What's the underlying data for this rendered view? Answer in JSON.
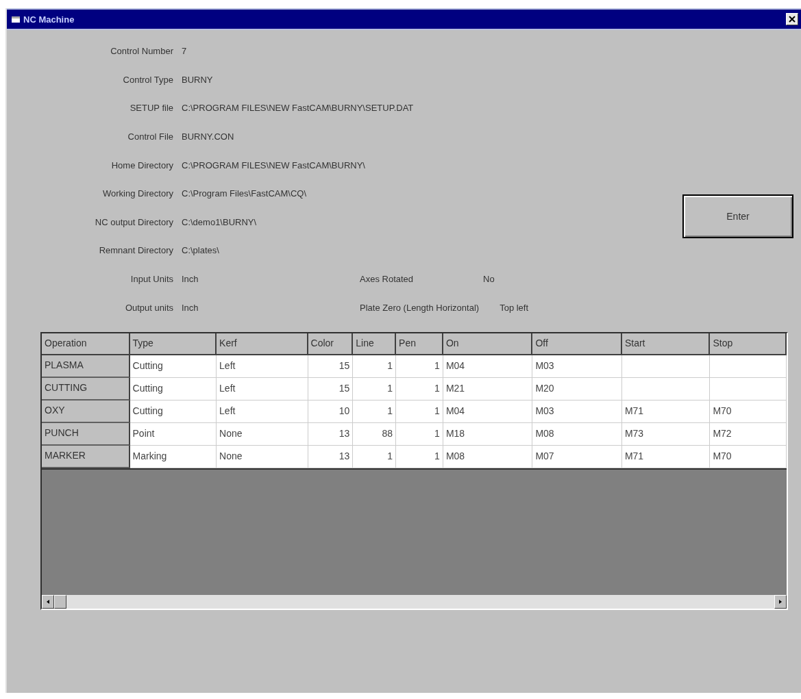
{
  "window": {
    "title": "NC Machine"
  },
  "fields": [
    {
      "label": "Control Number",
      "value": "7"
    },
    {
      "label": "Control Type",
      "value": "BURNY"
    },
    {
      "label": "SETUP file",
      "value": "C:\\PROGRAM FILES\\NEW FastCAM\\BURNY\\SETUP.DAT"
    },
    {
      "label": "Control File",
      "value": "BURNY.CON"
    },
    {
      "label": "Home Directory",
      "value": "C:\\PROGRAM FILES\\NEW FastCAM\\BURNY\\"
    },
    {
      "label": "Working Directory",
      "value": "C:\\Program Files\\FastCAM\\CQ\\"
    },
    {
      "label": "NC output Directory",
      "value": "C:\\demo1\\BURNY\\"
    },
    {
      "label": "Remnant Directory",
      "value": "C:\\plates\\"
    }
  ],
  "unit_rows": [
    {
      "label": "Input Units",
      "value": "Inch",
      "extra_label": "Axes Rotated",
      "extra_value": "No"
    },
    {
      "label": "Output units",
      "value": "Inch",
      "extra_label": "Plate Zero (Length Horizontal)",
      "extra_value": "Top left"
    }
  ],
  "enter_button": "Enter",
  "table": {
    "columns": [
      "Operation",
      "Type",
      "Kerf",
      "Color",
      "Line",
      "Pen",
      "On",
      "Off",
      "Start",
      "Stop"
    ],
    "rows": [
      [
        "PLASMA",
        "Cutting",
        "Left",
        "15",
        "1",
        "1",
        "M04",
        "M03",
        "",
        ""
      ],
      [
        "CUTTING",
        "Cutting",
        "Left",
        "15",
        "1",
        "1",
        "M21",
        "M20",
        "",
        ""
      ],
      [
        "OXY",
        "Cutting",
        "Left",
        "10",
        "1",
        "1",
        "M04",
        "M03",
        "M71",
        "M70"
      ],
      [
        "PUNCH",
        "Point",
        "None",
        "13",
        "88",
        "1",
        "M18",
        "M08",
        "M73",
        "M72"
      ],
      [
        "MARKER",
        "Marking",
        "None",
        "13",
        "1",
        "1",
        "M08",
        "M07",
        "M71",
        "M70"
      ]
    ]
  }
}
